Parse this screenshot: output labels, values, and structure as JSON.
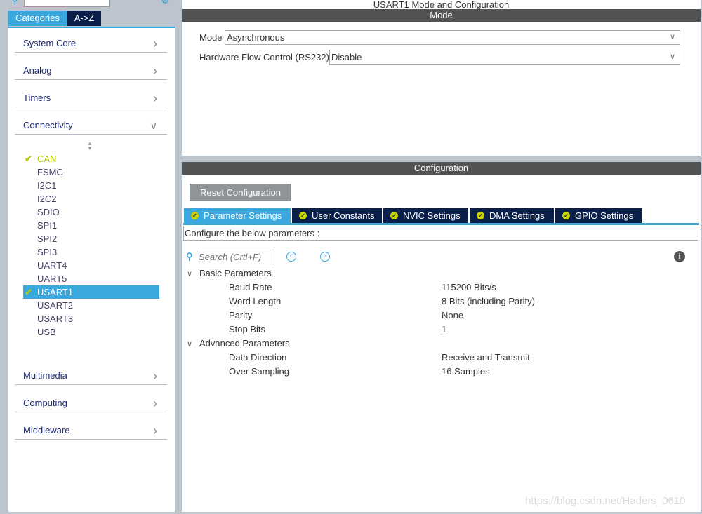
{
  "sidebar": {
    "tabs": [
      "Categories",
      "A->Z"
    ],
    "categories_top": [
      {
        "label": "System Core"
      },
      {
        "label": "Analog"
      },
      {
        "label": "Timers"
      },
      {
        "label": "Connectivity"
      }
    ],
    "connectivity_items": [
      {
        "label": "CAN",
        "status": "enabled"
      },
      {
        "label": "FSMC"
      },
      {
        "label": "I2C1"
      },
      {
        "label": "I2C2"
      },
      {
        "label": "SDIO"
      },
      {
        "label": "SPI1"
      },
      {
        "label": "SPI2"
      },
      {
        "label": "SPI3"
      },
      {
        "label": "UART4"
      },
      {
        "label": "UART5"
      },
      {
        "label": "USART1",
        "status": "selected"
      },
      {
        "label": "USART2"
      },
      {
        "label": "USART3"
      },
      {
        "label": "USB"
      }
    ],
    "categories_bottom": [
      {
        "label": "Multimedia"
      },
      {
        "label": "Computing"
      },
      {
        "label": "Middleware"
      }
    ]
  },
  "main": {
    "title": "USART1 Mode and Configuration",
    "mode_header": "Mode",
    "mode_label": "Mode",
    "mode_value": "Asynchronous",
    "hwfc_label": "Hardware Flow Control (RS232)",
    "hwfc_value": "Disable",
    "config_header": "Configuration",
    "reset_label": "Reset Configuration",
    "tabs": [
      "Parameter Settings",
      "User Constants",
      "NVIC Settings",
      "DMA Settings",
      "GPIO Settings"
    ],
    "hint": "Configure the below parameters :",
    "search_placeholder": "Search (Crtl+F)",
    "groups": [
      {
        "label": "Basic Parameters",
        "params": [
          [
            "Baud Rate",
            "115200 Bits/s"
          ],
          [
            "Word Length",
            "8 Bits (including Parity)"
          ],
          [
            "Parity",
            "None"
          ],
          [
            "Stop Bits",
            "1"
          ]
        ]
      },
      {
        "label": "Advanced Parameters",
        "params": [
          [
            "Data Direction",
            "Receive and Transmit"
          ],
          [
            "Over Sampling",
            "16 Samples"
          ]
        ]
      }
    ]
  },
  "watermark": "https://blog.csdn.net/Haders_0610",
  "colors": {
    "accent": "#3aa8dc",
    "navy": "#0a1f4a",
    "check": "#b5c800",
    "header": "#525453"
  }
}
